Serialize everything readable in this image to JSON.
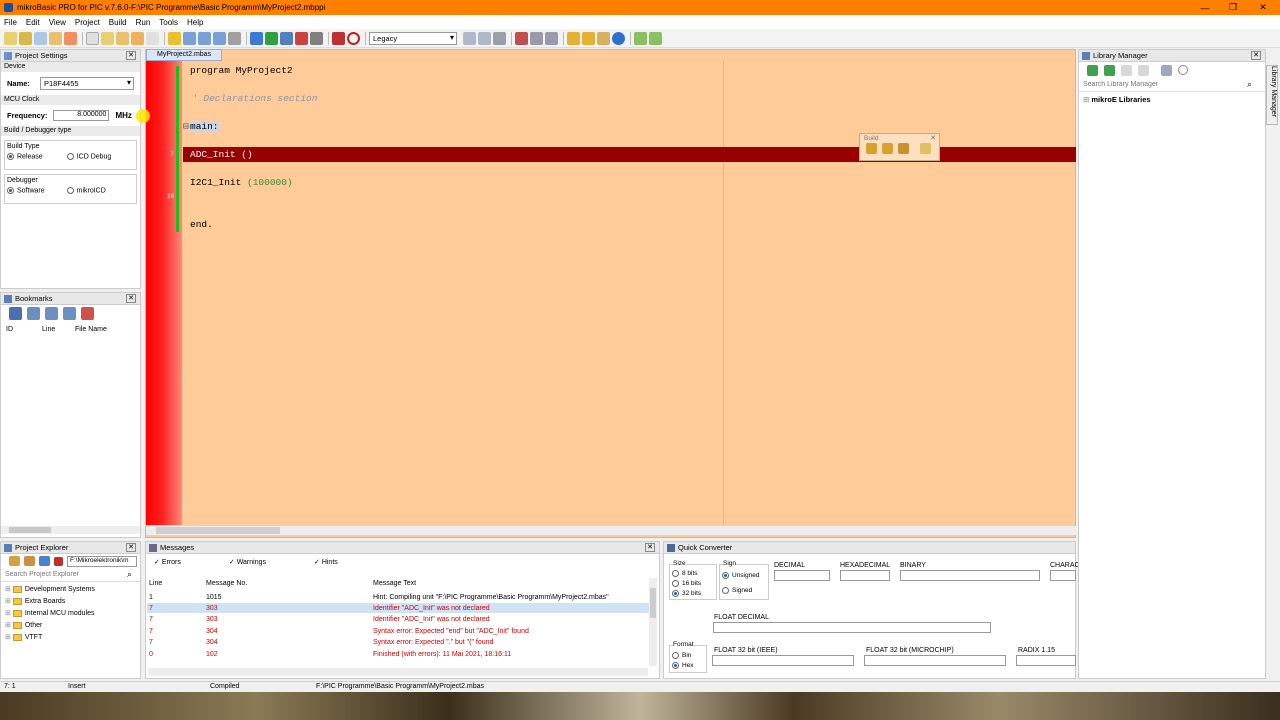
{
  "titlebar": {
    "title": "mikroBasic PRO for PIC v.7.6.0-F:\\PIC Programme\\Basic Programm\\MyProject2.mbppi",
    "minimize": "—",
    "maximize": "❐",
    "close": "✕"
  },
  "menu": [
    "File",
    "Edit",
    "View",
    "Project",
    "Build",
    "Run",
    "Tools",
    "Help"
  ],
  "toolbar": {
    "scheme_value": "Legacy"
  },
  "project_settings": {
    "title": "Project Settings",
    "device_section": "Device",
    "name_label": "Name:",
    "name_value": "P18F4455",
    "clock_section": "MCU Clock",
    "freq_label": "Frequency:",
    "freq_value": "8.000000",
    "freq_unit": "MHz",
    "build_section": "Build / Debugger type",
    "build_type_label": "Build Type",
    "release": "Release",
    "icd_debug": "ICD Debug",
    "debugger_label": "Debugger",
    "software": "Software",
    "mikroicd": "mikroICD"
  },
  "bookmarks": {
    "title": "Bookmarks",
    "col_id": "ID",
    "col_line": "Line",
    "col_file": "File Name"
  },
  "project_explorer": {
    "title": "Project Explorer",
    "path": "F:\\Mikroelektronik\\m",
    "search_placeholder": "Search Project Explorer",
    "items": [
      "Development Systems",
      "Extra Boards",
      "Internal MCU modules",
      "Other",
      "VTFT"
    ]
  },
  "editor": {
    "tab": "MyProject2.mbas",
    "lines": {
      "l1": "program MyProject2",
      "l3": "' Declarations section",
      "l5": "main:",
      "l7": "ADC_Init ()",
      "l9a": "I2C1_Init ",
      "l9b": "(100000)",
      "l12": "end."
    },
    "line_numbers": {
      "n7": "7",
      "n10": "10"
    }
  },
  "build_float": {
    "title": "Build"
  },
  "messages": {
    "title": "Messages",
    "errors": "Errors",
    "warnings": "Warnings",
    "hints": "Hints",
    "col_line": "Line",
    "col_no": "Message No.",
    "col_text": "Message Text",
    "rows": [
      {
        "line": "1",
        "no": "1015",
        "text": "Hint: Compiling unit \"F:\\PIC Programme\\Basic Programm\\MyProject2.mbas\""
      },
      {
        "line": "7",
        "no": "303",
        "text": "Identifier \"ADC_Init\" was not declared"
      },
      {
        "line": "7",
        "no": "303",
        "text": "Identifier \"ADC_Init\" was not declared"
      },
      {
        "line": "7",
        "no": "304",
        "text": "Syntax error: Expected \"end\" but \"ADC_Init\" found"
      },
      {
        "line": "7",
        "no": "304",
        "text": "Syntax error: Expected \".\" but \"(\" found"
      },
      {
        "line": "0",
        "no": "102",
        "text": "Finished (with errors): 11 Mai 2021, 18:16:11"
      }
    ]
  },
  "quick_converter": {
    "title": "Quick Converter",
    "size": "Size",
    "s8": "8 bits",
    "s16": "16 bits",
    "s32": "32 bits",
    "sign": "Sign",
    "unsigned": "Unsigned",
    "signed": "Signed",
    "decimal": "DECIMAL",
    "hex": "HEXADECIMAL",
    "binary": "BINARY",
    "chara": "CHARAC",
    "float_dec": "FLOAT DECIMAL",
    "format": "Format",
    "bin": "Bin",
    "hexf": "Hex",
    "f32ieee": "FLOAT 32 bit (IEEE)",
    "f32mchip": "FLOAT 32 bit (MICROCHIP)",
    "radix": "RADIX 1.15"
  },
  "library": {
    "title": "Library Manager",
    "search_placeholder": "Search Library Manager",
    "root": "mikroE Libraries",
    "vtab": "Library Manager"
  },
  "status": {
    "pos": "7: 1",
    "mode": "Insert",
    "state": "Compiled",
    "file": "F:\\PIC Programme\\Basic Programm\\MyProject2.mbas"
  }
}
